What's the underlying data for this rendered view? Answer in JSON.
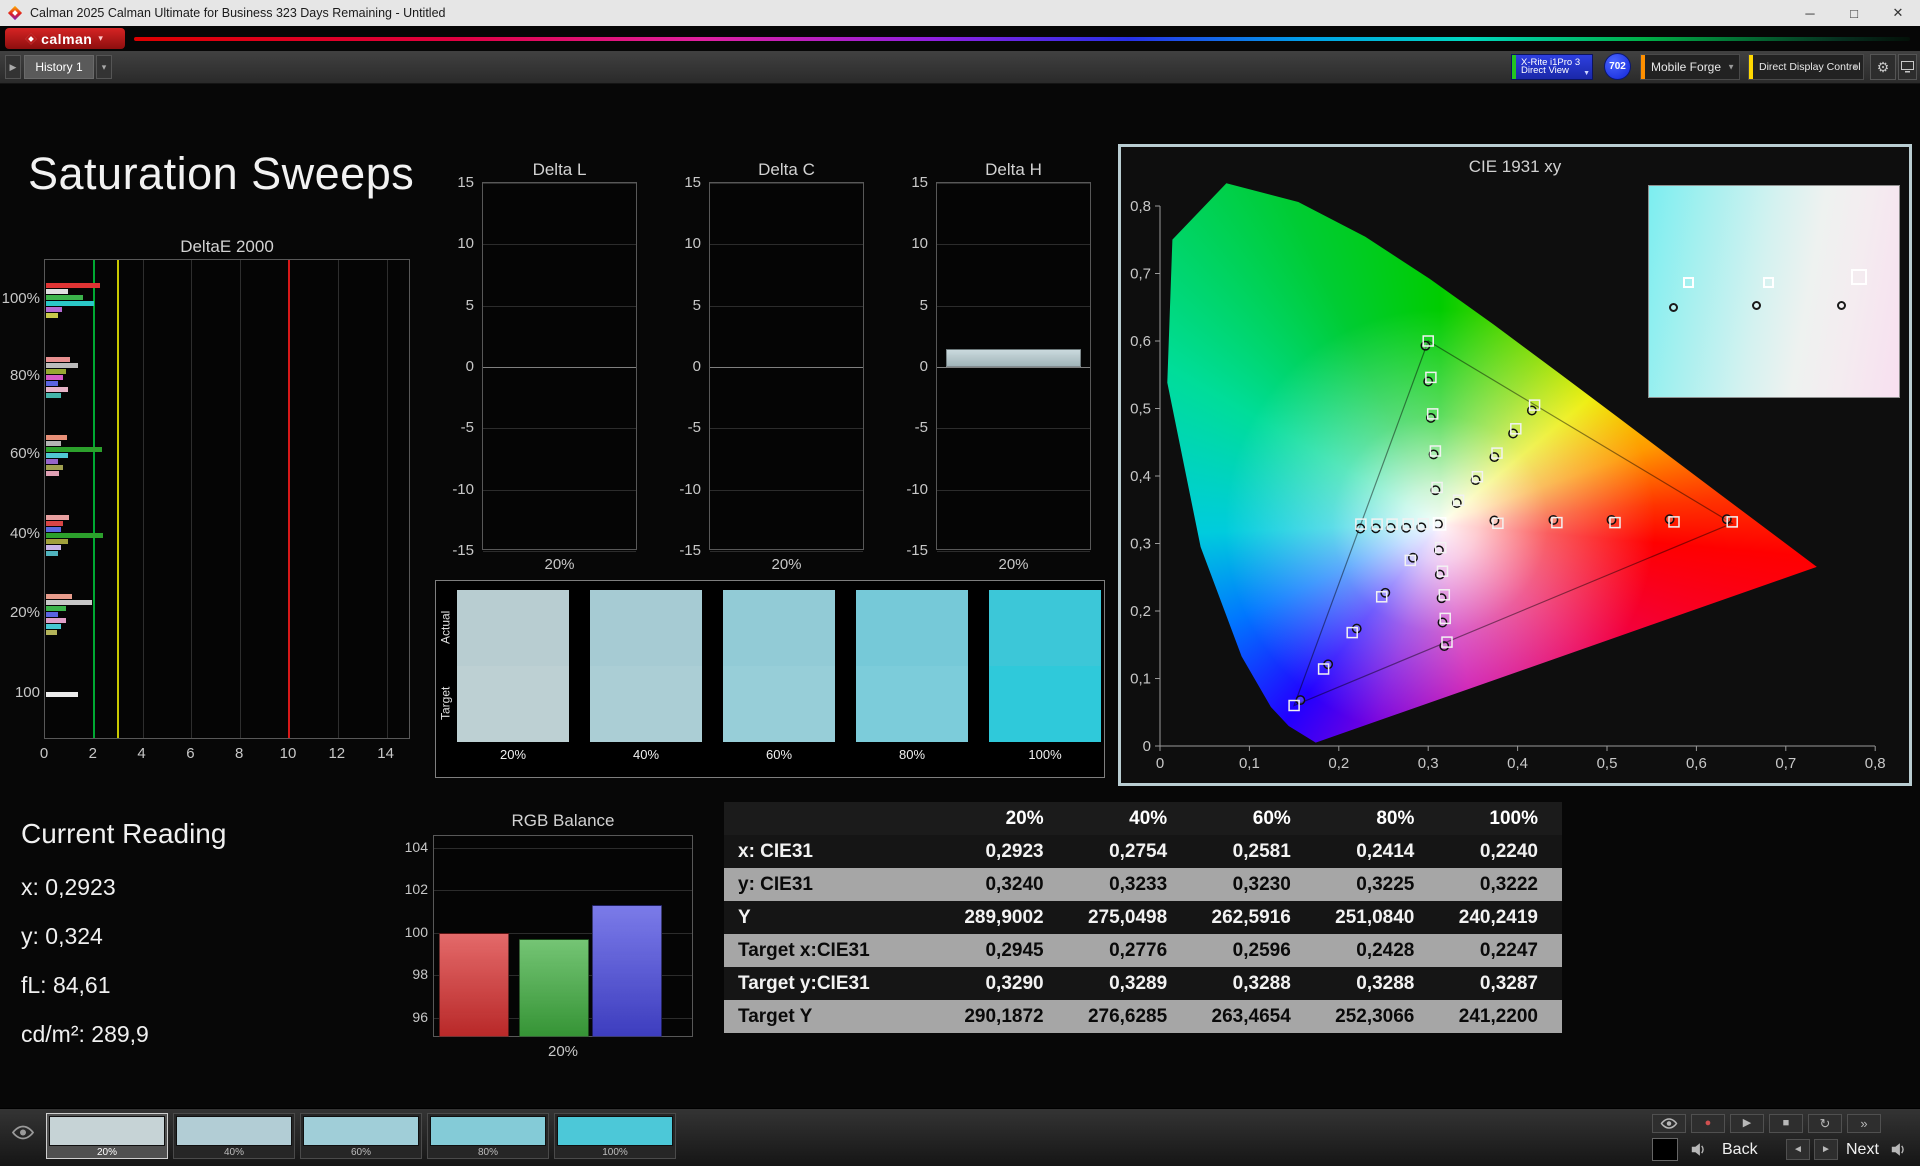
{
  "titlebar": {
    "title": "Calman 2025 Calman Ultimate for Business 323 Days Remaining  - Untitled",
    "minimize_icon": "─",
    "maximize_icon": "□",
    "close_icon": "✕"
  },
  "logobar": {
    "brand": "calman",
    "brand_caret": "▾"
  },
  "toolbar": {
    "expand_icon": "▶",
    "history_tab": "History 1",
    "tab_caret_icon": "▾",
    "meter_button": {
      "line1": "X-Rite i1Pro 3",
      "line2": "Direct View",
      "caret": "▼"
    },
    "badge": "702",
    "source_button": {
      "label": "Mobile Forge",
      "caret": "▼"
    },
    "display_button": {
      "label": "Direct Display Control",
      "caret": "▼"
    },
    "gear_icon": "⚙"
  },
  "page": {
    "title": "Saturation Sweeps"
  },
  "current_reading": {
    "title": "Current Reading",
    "lines": [
      "x: 0,2923",
      "y: 0,324",
      "fL: 84,61",
      "cd/m²: 289,9"
    ]
  },
  "charts": {
    "deltae": {
      "type": "bar",
      "title": "DeltaE 2000",
      "x_ticks": [
        "0",
        "2",
        "4",
        "6",
        "8",
        "10",
        "12",
        "14"
      ],
      "x_max": 15,
      "ref_lines": [
        {
          "value": 2,
          "color": "#00a832"
        },
        {
          "value": 3,
          "color": "#c8c800"
        },
        {
          "value": 10,
          "color": "#d81818"
        }
      ],
      "groups": [
        {
          "label": "100%",
          "bars": [
            {
              "color": "#e03434",
              "value": 2.2
            },
            {
              "color": "#e0e0e0",
              "value": 0.9
            },
            {
              "color": "#3cb44b",
              "value": 1.5
            },
            {
              "color": "#2bc8c8",
              "value": 1.95
            },
            {
              "color": "#b46ad4",
              "value": 0.65
            },
            {
              "color": "#c8c84a",
              "value": 0.5
            }
          ]
        },
        {
          "label": "80%",
          "bars": [
            {
              "color": "#e89090",
              "value": 1.0
            },
            {
              "color": "#bcbcbc",
              "value": 1.3
            },
            {
              "color": "#96a832",
              "value": 0.8
            },
            {
              "color": "#d45ac8",
              "value": 0.7
            },
            {
              "color": "#5a64e0",
              "value": 0.5
            },
            {
              "color": "#e8b4c8",
              "value": 0.9
            },
            {
              "color": "#46b4aa",
              "value": 0.6
            }
          ]
        },
        {
          "label": "60%",
          "bars": [
            {
              "color": "#e89078",
              "value": 0.85
            },
            {
              "color": "#b4b4b4",
              "value": 0.6
            },
            {
              "color": "#2ca02c",
              "value": 2.3
            },
            {
              "color": "#50c8d2",
              "value": 0.9
            },
            {
              "color": "#9664c8",
              "value": 0.5
            },
            {
              "color": "#a0a050",
              "value": 0.7
            },
            {
              "color": "#e0a0b4",
              "value": 0.55
            }
          ]
        },
        {
          "label": "40%",
          "bars": [
            {
              "color": "#e8a0a0",
              "value": 0.95
            },
            {
              "color": "#d84646",
              "value": 0.7
            },
            {
              "color": "#5a6ae0",
              "value": 0.6
            },
            {
              "color": "#2ca02c",
              "value": 2.35
            },
            {
              "color": "#a0a03c",
              "value": 0.9
            },
            {
              "color": "#c8b4e8",
              "value": 0.6
            },
            {
              "color": "#50b4be",
              "value": 0.5
            }
          ]
        },
        {
          "label": "20%",
          "bars": [
            {
              "color": "#e89c8c",
              "value": 1.05
            },
            {
              "color": "#c8c8c8",
              "value": 1.9
            },
            {
              "color": "#3cb44b",
              "value": 0.8
            },
            {
              "color": "#5a64e0",
              "value": 0.5
            },
            {
              "color": "#e0a0c8",
              "value": 0.8
            },
            {
              "color": "#46c8d2",
              "value": 0.6
            },
            {
              "color": "#b4b45a",
              "value": 0.45
            }
          ]
        },
        {
          "label": "100",
          "bars": [
            {
              "color": "#ececec",
              "value": 1.3
            }
          ]
        }
      ]
    },
    "delta_l": {
      "type": "bar",
      "title": "Delta L",
      "y_ticks": [
        "15",
        "10",
        "5",
        "0",
        "-5",
        "-10",
        "-15"
      ],
      "y_range": [
        -15,
        15
      ],
      "x_label": "20%",
      "bars": []
    },
    "delta_c": {
      "type": "bar",
      "title": "Delta C",
      "y_ticks": [
        "15",
        "10",
        "5",
        "0",
        "-5",
        "-10",
        "-15"
      ],
      "y_range": [
        -15,
        15
      ],
      "x_label": "20%",
      "bars": []
    },
    "delta_h": {
      "type": "bar",
      "title": "Delta H",
      "y_ticks": [
        "15",
        "10",
        "5",
        "0",
        "-5",
        "-10",
        "-15"
      ],
      "y_range": [
        -15,
        15
      ],
      "x_label": "20%",
      "bars": [
        {
          "value": 1.5,
          "color": "#b8cdd2"
        }
      ]
    },
    "swatches": {
      "row_labels": [
        "Actual",
        "Target"
      ],
      "columns": [
        {
          "label": "20%",
          "actual": "#b8cdd1",
          "target": "#bdd0d3"
        },
        {
          "label": "40%",
          "actual": "#a6cbd3",
          "target": "#abced5"
        },
        {
          "label": "60%",
          "actual": "#92cbd6",
          "target": "#97ced8"
        },
        {
          "label": "80%",
          "actual": "#76c9d8",
          "target": "#7cccda"
        },
        {
          "label": "100%",
          "actual": "#3cc7d8",
          "target": "#2fc9da"
        }
      ]
    },
    "cie": {
      "type": "scatter",
      "title": "CIE 1931 xy",
      "x_ticks": [
        "0",
        "0,1",
        "0,2",
        "0,3",
        "0,4",
        "0,5",
        "0,6",
        "0,7",
        "0,8"
      ],
      "y_ticks": [
        "0",
        "0,1",
        "0,2",
        "0,3",
        "0,4",
        "0,5",
        "0,6",
        "0,7",
        "0,8"
      ],
      "gamut_triangle": [
        [
          0.64,
          0.33
        ],
        [
          0.3,
          0.6
        ],
        [
          0.15,
          0.06
        ]
      ],
      "white_point": [
        0.3127,
        0.329
      ],
      "sweeps": [
        {
          "name": "red",
          "targets": [
            [
              0.378,
              0.33
            ],
            [
              0.444,
              0.331
            ],
            [
              0.509,
              0.331
            ],
            [
              0.575,
              0.332
            ],
            [
              0.64,
              0.332
            ]
          ],
          "measured": [
            [
              0.374,
              0.334
            ],
            [
              0.44,
              0.335
            ],
            [
              0.505,
              0.335
            ],
            [
              0.57,
              0.336
            ],
            [
              0.634,
              0.336
            ]
          ]
        },
        {
          "name": "green",
          "targets": [
            [
              0.31,
              0.383
            ],
            [
              0.308,
              0.437
            ],
            [
              0.305,
              0.492
            ],
            [
              0.303,
              0.546
            ],
            [
              0.3,
              0.6
            ]
          ],
          "measured": [
            [
              0.308,
              0.379
            ],
            [
              0.306,
              0.432
            ],
            [
              0.303,
              0.486
            ],
            [
              0.3,
              0.54
            ],
            [
              0.297,
              0.593
            ]
          ]
        },
        {
          "name": "blue",
          "targets": [
            [
              0.28,
              0.275
            ],
            [
              0.248,
              0.221
            ],
            [
              0.215,
              0.168
            ],
            [
              0.183,
              0.114
            ],
            [
              0.15,
              0.06
            ]
          ],
          "measured": [
            [
              0.283,
              0.279
            ],
            [
              0.252,
              0.227
            ],
            [
              0.22,
              0.174
            ],
            [
              0.188,
              0.121
            ],
            [
              0.157,
              0.068
            ]
          ]
        },
        {
          "name": "cyan",
          "targets": [
            [
              0.2945,
              0.329
            ],
            [
              0.2776,
              0.3289
            ],
            [
              0.2596,
              0.3288
            ],
            [
              0.2428,
              0.3288
            ],
            [
              0.2247,
              0.3287
            ]
          ],
          "measured": [
            [
              0.2923,
              0.324
            ],
            [
              0.2754,
              0.3233
            ],
            [
              0.2581,
              0.323
            ],
            [
              0.2414,
              0.3225
            ],
            [
              0.224,
              0.3222
            ]
          ]
        },
        {
          "name": "magenta",
          "targets": [
            [
              0.314,
              0.294
            ],
            [
              0.316,
              0.259
            ],
            [
              0.318,
              0.224
            ],
            [
              0.319,
              0.189
            ],
            [
              0.321,
              0.154
            ]
          ],
          "measured": [
            [
              0.312,
              0.29
            ],
            [
              0.313,
              0.254
            ],
            [
              0.315,
              0.219
            ],
            [
              0.316,
              0.183
            ],
            [
              0.318,
              0.148
            ]
          ]
        },
        {
          "name": "yellow",
          "targets": [
            [
              0.334,
              0.364
            ],
            [
              0.355,
              0.399
            ],
            [
              0.377,
              0.434
            ],
            [
              0.398,
              0.47
            ],
            [
              0.419,
              0.505
            ]
          ],
          "measured": [
            [
              0.332,
              0.36
            ],
            [
              0.353,
              0.394
            ],
            [
              0.374,
              0.428
            ],
            [
              0.395,
              0.463
            ],
            [
              0.416,
              0.497
            ]
          ]
        },
        {
          "name": "white",
          "targets": [
            [
              0.3127,
              0.329
            ]
          ],
          "measured": [
            [
              0.311,
              0.3287
            ]
          ]
        }
      ],
      "inset": {
        "squares": [
          [
            16,
            46
          ],
          [
            48,
            46
          ],
          [
            84,
            43
          ]
        ],
        "dots": [
          [
            10,
            58
          ],
          [
            43,
            57
          ],
          [
            77,
            57
          ]
        ]
      }
    },
    "rgb": {
      "type": "bar",
      "title": "RGB Balance",
      "y_ticks": [
        "104",
        "102",
        "100",
        "98",
        "96"
      ],
      "y_range": [
        95.06,
        104.56
      ],
      "x_label": "20%",
      "bars": [
        {
          "name": "red",
          "value": 100.0,
          "color": "#d93030"
        },
        {
          "name": "green",
          "value": 99.7,
          "color": "#3fae3f"
        },
        {
          "name": "blue",
          "value": 101.3,
          "color": "#4848e0"
        }
      ]
    }
  },
  "table": {
    "header": [
      "",
      "20%",
      "40%",
      "60%",
      "80%",
      "100%"
    ],
    "rows": [
      {
        "label": "x: CIE31",
        "shade": "dark",
        "values": [
          "0,2923",
          "0,2754",
          "0,2581",
          "0,2414",
          "0,2240"
        ]
      },
      {
        "label": "y: CIE31",
        "shade": "light",
        "values": [
          "0,3240",
          "0,3233",
          "0,3230",
          "0,3225",
          "0,3222"
        ]
      },
      {
        "label": "Y",
        "shade": "dark",
        "values": [
          "289,9002",
          "275,0498",
          "262,5916",
          "251,0840",
          "240,2419"
        ]
      },
      {
        "label": "Target x:CIE31",
        "shade": "light",
        "values": [
          "0,2945",
          "0,2776",
          "0,2596",
          "0,2428",
          "0,2247"
        ]
      },
      {
        "label": "Target y:CIE31",
        "shade": "dark",
        "values": [
          "0,3290",
          "0,3289",
          "0,3288",
          "0,3288",
          "0,3287"
        ]
      },
      {
        "label": "Target Y",
        "shade": "light",
        "values": [
          "290,1872",
          "276,6285",
          "263,4654",
          "252,3066",
          "241,2200"
        ]
      }
    ]
  },
  "bottombar": {
    "swatches": [
      {
        "label": "20%",
        "color": "#c6d3d6",
        "selected": true
      },
      {
        "label": "40%",
        "color": "#b2cdd5",
        "selected": false
      },
      {
        "label": "60%",
        "color": "#a0ced8",
        "selected": false
      },
      {
        "label": "80%",
        "color": "#84cbd7",
        "selected": false
      },
      {
        "label": "100%",
        "color": "#4cc8d8",
        "selected": false
      }
    ],
    "icons": {
      "record": "●",
      "play": "▶",
      "stop": "■",
      "refresh": "↻",
      "skip": "»",
      "prev": "◄",
      "next": "►"
    },
    "back_label": "Back",
    "next_label": "Next"
  }
}
